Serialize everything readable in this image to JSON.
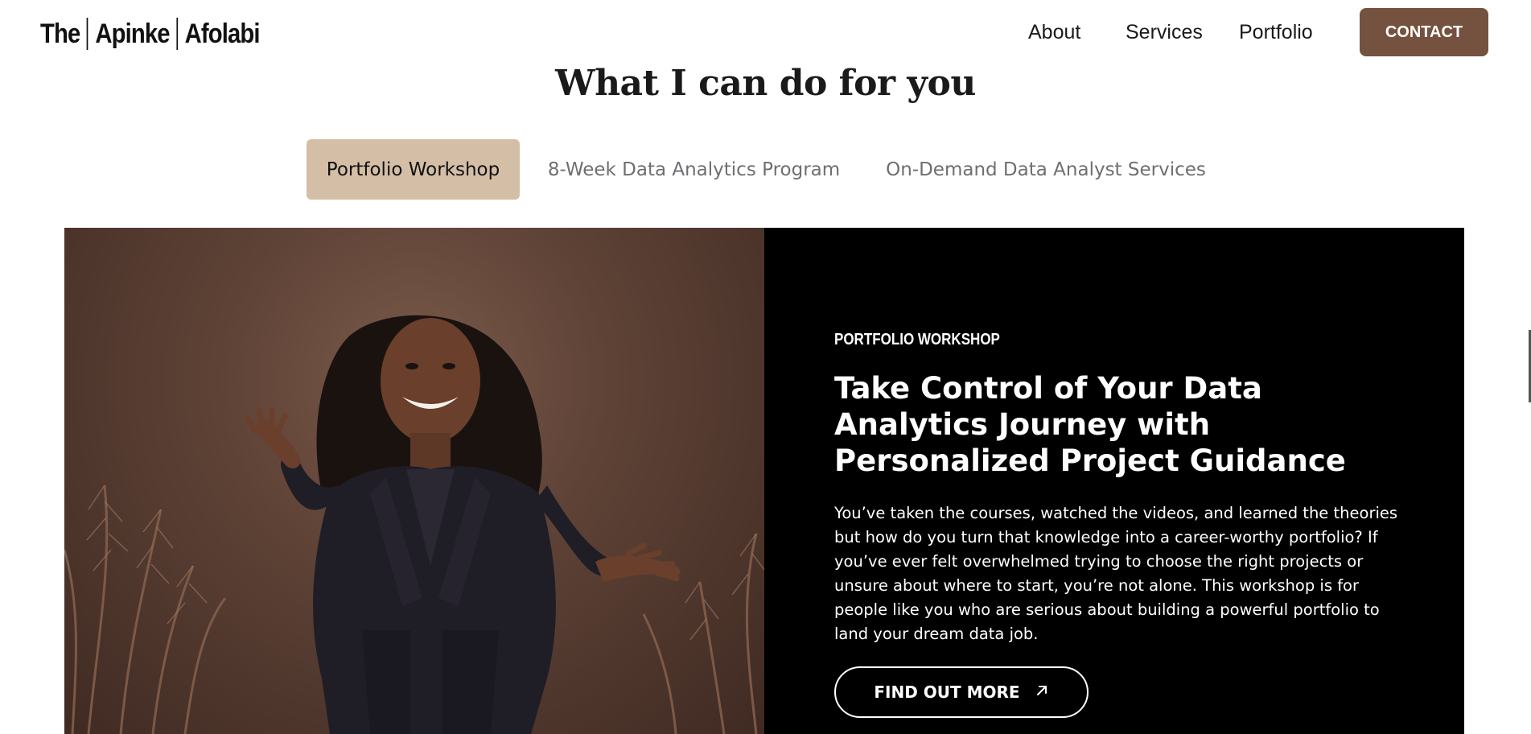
{
  "header": {
    "logo": {
      "part1": "The",
      "part2": "Apinke",
      "part3": "Afolabi"
    },
    "nav": [
      {
        "label": "About"
      },
      {
        "label": "Services"
      },
      {
        "label": "Portfolio"
      }
    ],
    "contact_label": "CONTACT"
  },
  "section": {
    "title": "What I can do for you",
    "tabs": [
      {
        "label": "Portfolio Workshop",
        "active": true
      },
      {
        "label": "8-Week Data Analytics Program",
        "active": false
      },
      {
        "label": "On-Demand Data Analyst Services",
        "active": false
      }
    ]
  },
  "panel": {
    "eyebrow": "PORTFOLIO WORKSHOP",
    "headline": "Take Control of Your Data Analytics Journey with Personalized Project Guidance",
    "body": "You’ve taken the courses, watched the videos, and learned the theories but how do you turn that knowledge into a career-worthy portfolio? If you’ve ever felt overwhelmed trying to choose the right projects or unsure about where to start, you’re not alone. This workshop is for people like you who are serious about building a powerful portfolio to land your dream data job.",
    "cta_label": "FIND OUT MORE",
    "cta_icon": "arrow-up-right-icon"
  },
  "colors": {
    "brand_brown": "#74523f",
    "active_tab": "#d4bea6",
    "inactive_tab_text": "#6f6f73",
    "panel_dark": "#000000"
  }
}
